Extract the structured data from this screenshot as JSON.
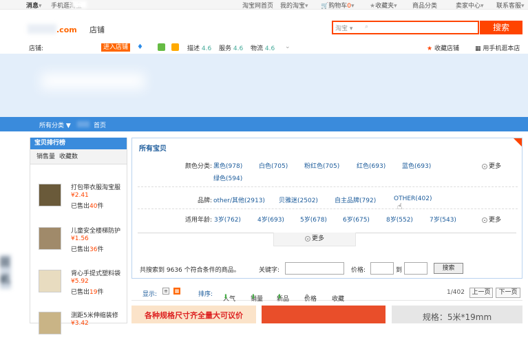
{
  "topbar": {
    "items": [
      {
        "label": "消息",
        "caret": "▾"
      },
      {
        "label": "手机逛淘宝"
      },
      {
        "label": "淘宝网首页"
      },
      {
        "label": "我的淘宝",
        "caret": "▾"
      },
      {
        "label": "购物车",
        "count": "0",
        "caret": "▾"
      },
      {
        "label": "收藏夹",
        "caret": "▾"
      },
      {
        "label": "商品分类"
      },
      {
        "label": "卖家中心",
        "caret": "▾"
      },
      {
        "label": "联系客服",
        "caret": "▾"
      }
    ]
  },
  "header": {
    "logo_suffix": ".com",
    "shop_word": "店铺",
    "search_scope": "淘宝",
    "search_button": "搜索",
    "shop_label": "店铺:",
    "enter_shop": "进入店铺",
    "ratings": [
      {
        "label": "描述",
        "value": "4.6"
      },
      {
        "label": "服务",
        "value": "4.6"
      },
      {
        "label": "物流",
        "value": "4.6"
      }
    ],
    "favorite_shop": "收藏店铺",
    "mobile_shop": "用手机逛本店"
  },
  "nav": {
    "all_categories": "所有分类 ▼",
    "home": "首页"
  },
  "sidebar": {
    "title": "宝贝排行榜",
    "tabs": [
      "销售量",
      "收藏数"
    ],
    "products": [
      {
        "name": "打包带衣服淘宝服",
        "price": "¥2.41",
        "sold_prefix": "已售出",
        "sold": "40",
        "sold_suffix": "件"
      },
      {
        "name": "儿童安全楼梯防护",
        "price": "¥1.56",
        "sold_prefix": "已售出",
        "sold": "36",
        "sold_suffix": "件"
      },
      {
        "name": "背心手提式塑料袋",
        "price": "¥5.92",
        "sold_prefix": "已售出",
        "sold": "19",
        "sold_suffix": "件"
      },
      {
        "name": "测距5米伸缩装修",
        "price": "¥3.42",
        "sold_prefix": "已售出",
        "sold": "",
        "sold_suffix": ""
      }
    ]
  },
  "main": {
    "title": "所有宝贝",
    "filters": [
      {
        "label": "颜色分类:",
        "values": [
          "黑色(978)",
          "白色(705)",
          "粉红色(705)",
          "红色(693)",
          "蓝色(693)",
          "绿色(594)"
        ],
        "more": "更多"
      },
      {
        "label": "品牌:",
        "values": [
          "other/其他(2913)",
          "贝雅迷(2502)",
          "自主品牌(792)",
          "OTHER(402)"
        ],
        "more": ""
      },
      {
        "label": "适用年龄:",
        "values": [
          "3岁(762)",
          "4岁(693)",
          "5岁(678)",
          "6岁(675)",
          "8岁(552)",
          "7岁(543)"
        ],
        "more": "更多"
      }
    ],
    "more_toggle": "更多",
    "search_summary": "共搜索到 9636 个符合条件的商品。",
    "keyword_label": "关键字:",
    "price_label": "价格:",
    "to_label": "到",
    "search_button": "搜索"
  },
  "sortbar": {
    "display_label": "显示:",
    "sort_label": "排序:",
    "sorts": [
      "人气",
      "销量",
      "新品",
      "价格",
      "收藏"
    ],
    "page_indicator": "1/402",
    "prev": "上一页",
    "next": "下一页"
  },
  "banners": {
    "b1": "各种规格尺寸齐全量大可议价",
    "b2": "规格：5米*19mm"
  },
  "side_fragment": "回机"
}
